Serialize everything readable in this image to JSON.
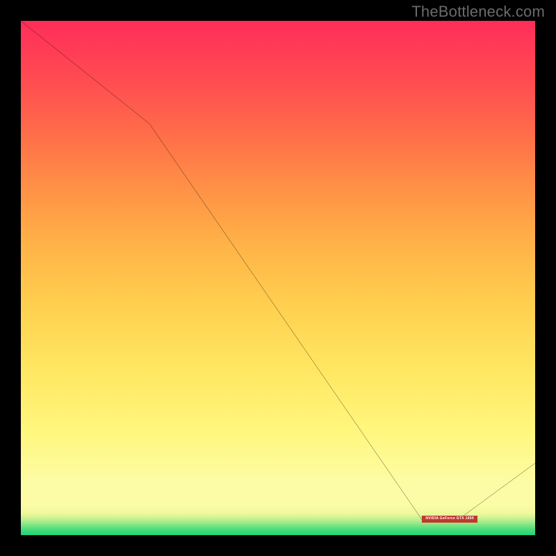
{
  "attribution": "TheBottleneck.com",
  "marker_label": "NVIDIA GeForce GTX 1650",
  "chart_data": {
    "type": "line",
    "title": "",
    "xlabel": "",
    "ylabel": "",
    "xlim": [
      0,
      100
    ],
    "ylim": [
      0,
      100
    ],
    "grid": false,
    "series": [
      {
        "name": "bottleneck-curve",
        "x": [
          0,
          25,
          78,
          85,
          100
        ],
        "values": [
          100,
          80,
          3,
          3,
          14
        ]
      }
    ],
    "markers": [
      {
        "name": "gpu-marker",
        "x_range": [
          78,
          88
        ],
        "y": 3,
        "label": "NVIDIA GeForce GTX 1650"
      }
    ],
    "gradient_stops": [
      {
        "pct": 0,
        "color": "#1fd37a"
      },
      {
        "pct": 4,
        "color": "#f0f99c"
      },
      {
        "pct": 10,
        "color": "#fdfca6"
      },
      {
        "pct": 50,
        "color": "#ffc34c"
      },
      {
        "pct": 100,
        "color": "#ff2d59"
      }
    ]
  }
}
